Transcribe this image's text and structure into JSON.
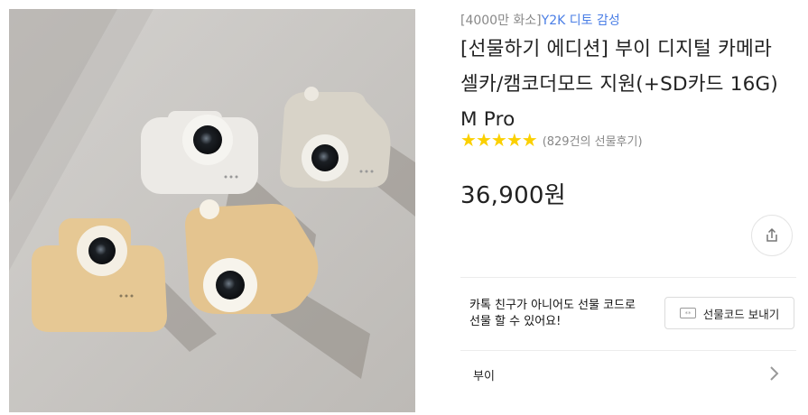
{
  "product": {
    "tag": "[4000만 화소]",
    "brand_tag": "Y2K 디토 감성",
    "title": "[선물하기 에디션] 부이 디지털 카메라 셀카/캠코더모드 지원(+SD카드 16G) M Pro",
    "rating_stars": 5,
    "review_text": "(829건의 선물후기)",
    "price": "36,900원"
  },
  "gift": {
    "message_line1": "카톡 친구가 아니어도 선물 코드로",
    "message_line2": "선물 할 수 있어요!",
    "button_label": "선물코드 보내기"
  },
  "option": {
    "label": "부이"
  },
  "icons": {
    "share": "share-icon",
    "gift_code": "gift-code-icon",
    "chevron": "chevron-right-icon",
    "star": "star-icon"
  },
  "colors": {
    "star": "#fbd000",
    "brand_link": "#4a7ee6",
    "muted_text": "#888888"
  }
}
